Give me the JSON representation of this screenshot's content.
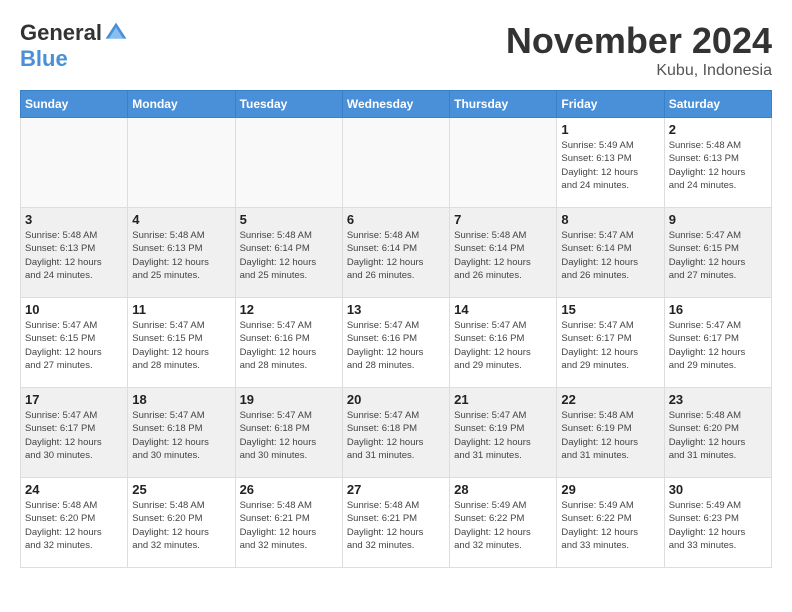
{
  "logo": {
    "general": "General",
    "blue": "Blue"
  },
  "title": "November 2024",
  "location": "Kubu, Indonesia",
  "days_of_week": [
    "Sunday",
    "Monday",
    "Tuesday",
    "Wednesday",
    "Thursday",
    "Friday",
    "Saturday"
  ],
  "weeks": [
    [
      {
        "day": "",
        "info": ""
      },
      {
        "day": "",
        "info": ""
      },
      {
        "day": "",
        "info": ""
      },
      {
        "day": "",
        "info": ""
      },
      {
        "day": "",
        "info": ""
      },
      {
        "day": "1",
        "info": "Sunrise: 5:49 AM\nSunset: 6:13 PM\nDaylight: 12 hours\nand 24 minutes."
      },
      {
        "day": "2",
        "info": "Sunrise: 5:48 AM\nSunset: 6:13 PM\nDaylight: 12 hours\nand 24 minutes."
      }
    ],
    [
      {
        "day": "3",
        "info": "Sunrise: 5:48 AM\nSunset: 6:13 PM\nDaylight: 12 hours\nand 24 minutes."
      },
      {
        "day": "4",
        "info": "Sunrise: 5:48 AM\nSunset: 6:13 PM\nDaylight: 12 hours\nand 25 minutes."
      },
      {
        "day": "5",
        "info": "Sunrise: 5:48 AM\nSunset: 6:14 PM\nDaylight: 12 hours\nand 25 minutes."
      },
      {
        "day": "6",
        "info": "Sunrise: 5:48 AM\nSunset: 6:14 PM\nDaylight: 12 hours\nand 26 minutes."
      },
      {
        "day": "7",
        "info": "Sunrise: 5:48 AM\nSunset: 6:14 PM\nDaylight: 12 hours\nand 26 minutes."
      },
      {
        "day": "8",
        "info": "Sunrise: 5:47 AM\nSunset: 6:14 PM\nDaylight: 12 hours\nand 26 minutes."
      },
      {
        "day": "9",
        "info": "Sunrise: 5:47 AM\nSunset: 6:15 PM\nDaylight: 12 hours\nand 27 minutes."
      }
    ],
    [
      {
        "day": "10",
        "info": "Sunrise: 5:47 AM\nSunset: 6:15 PM\nDaylight: 12 hours\nand 27 minutes."
      },
      {
        "day": "11",
        "info": "Sunrise: 5:47 AM\nSunset: 6:15 PM\nDaylight: 12 hours\nand 28 minutes."
      },
      {
        "day": "12",
        "info": "Sunrise: 5:47 AM\nSunset: 6:16 PM\nDaylight: 12 hours\nand 28 minutes."
      },
      {
        "day": "13",
        "info": "Sunrise: 5:47 AM\nSunset: 6:16 PM\nDaylight: 12 hours\nand 28 minutes."
      },
      {
        "day": "14",
        "info": "Sunrise: 5:47 AM\nSunset: 6:16 PM\nDaylight: 12 hours\nand 29 minutes."
      },
      {
        "day": "15",
        "info": "Sunrise: 5:47 AM\nSunset: 6:17 PM\nDaylight: 12 hours\nand 29 minutes."
      },
      {
        "day": "16",
        "info": "Sunrise: 5:47 AM\nSunset: 6:17 PM\nDaylight: 12 hours\nand 29 minutes."
      }
    ],
    [
      {
        "day": "17",
        "info": "Sunrise: 5:47 AM\nSunset: 6:17 PM\nDaylight: 12 hours\nand 30 minutes."
      },
      {
        "day": "18",
        "info": "Sunrise: 5:47 AM\nSunset: 6:18 PM\nDaylight: 12 hours\nand 30 minutes."
      },
      {
        "day": "19",
        "info": "Sunrise: 5:47 AM\nSunset: 6:18 PM\nDaylight: 12 hours\nand 30 minutes."
      },
      {
        "day": "20",
        "info": "Sunrise: 5:47 AM\nSunset: 6:18 PM\nDaylight: 12 hours\nand 31 minutes."
      },
      {
        "day": "21",
        "info": "Sunrise: 5:47 AM\nSunset: 6:19 PM\nDaylight: 12 hours\nand 31 minutes."
      },
      {
        "day": "22",
        "info": "Sunrise: 5:48 AM\nSunset: 6:19 PM\nDaylight: 12 hours\nand 31 minutes."
      },
      {
        "day": "23",
        "info": "Sunrise: 5:48 AM\nSunset: 6:20 PM\nDaylight: 12 hours\nand 31 minutes."
      }
    ],
    [
      {
        "day": "24",
        "info": "Sunrise: 5:48 AM\nSunset: 6:20 PM\nDaylight: 12 hours\nand 32 minutes."
      },
      {
        "day": "25",
        "info": "Sunrise: 5:48 AM\nSunset: 6:20 PM\nDaylight: 12 hours\nand 32 minutes."
      },
      {
        "day": "26",
        "info": "Sunrise: 5:48 AM\nSunset: 6:21 PM\nDaylight: 12 hours\nand 32 minutes."
      },
      {
        "day": "27",
        "info": "Sunrise: 5:48 AM\nSunset: 6:21 PM\nDaylight: 12 hours\nand 32 minutes."
      },
      {
        "day": "28",
        "info": "Sunrise: 5:49 AM\nSunset: 6:22 PM\nDaylight: 12 hours\nand 32 minutes."
      },
      {
        "day": "29",
        "info": "Sunrise: 5:49 AM\nSunset: 6:22 PM\nDaylight: 12 hours\nand 33 minutes."
      },
      {
        "day": "30",
        "info": "Sunrise: 5:49 AM\nSunset: 6:23 PM\nDaylight: 12 hours\nand 33 minutes."
      }
    ]
  ]
}
